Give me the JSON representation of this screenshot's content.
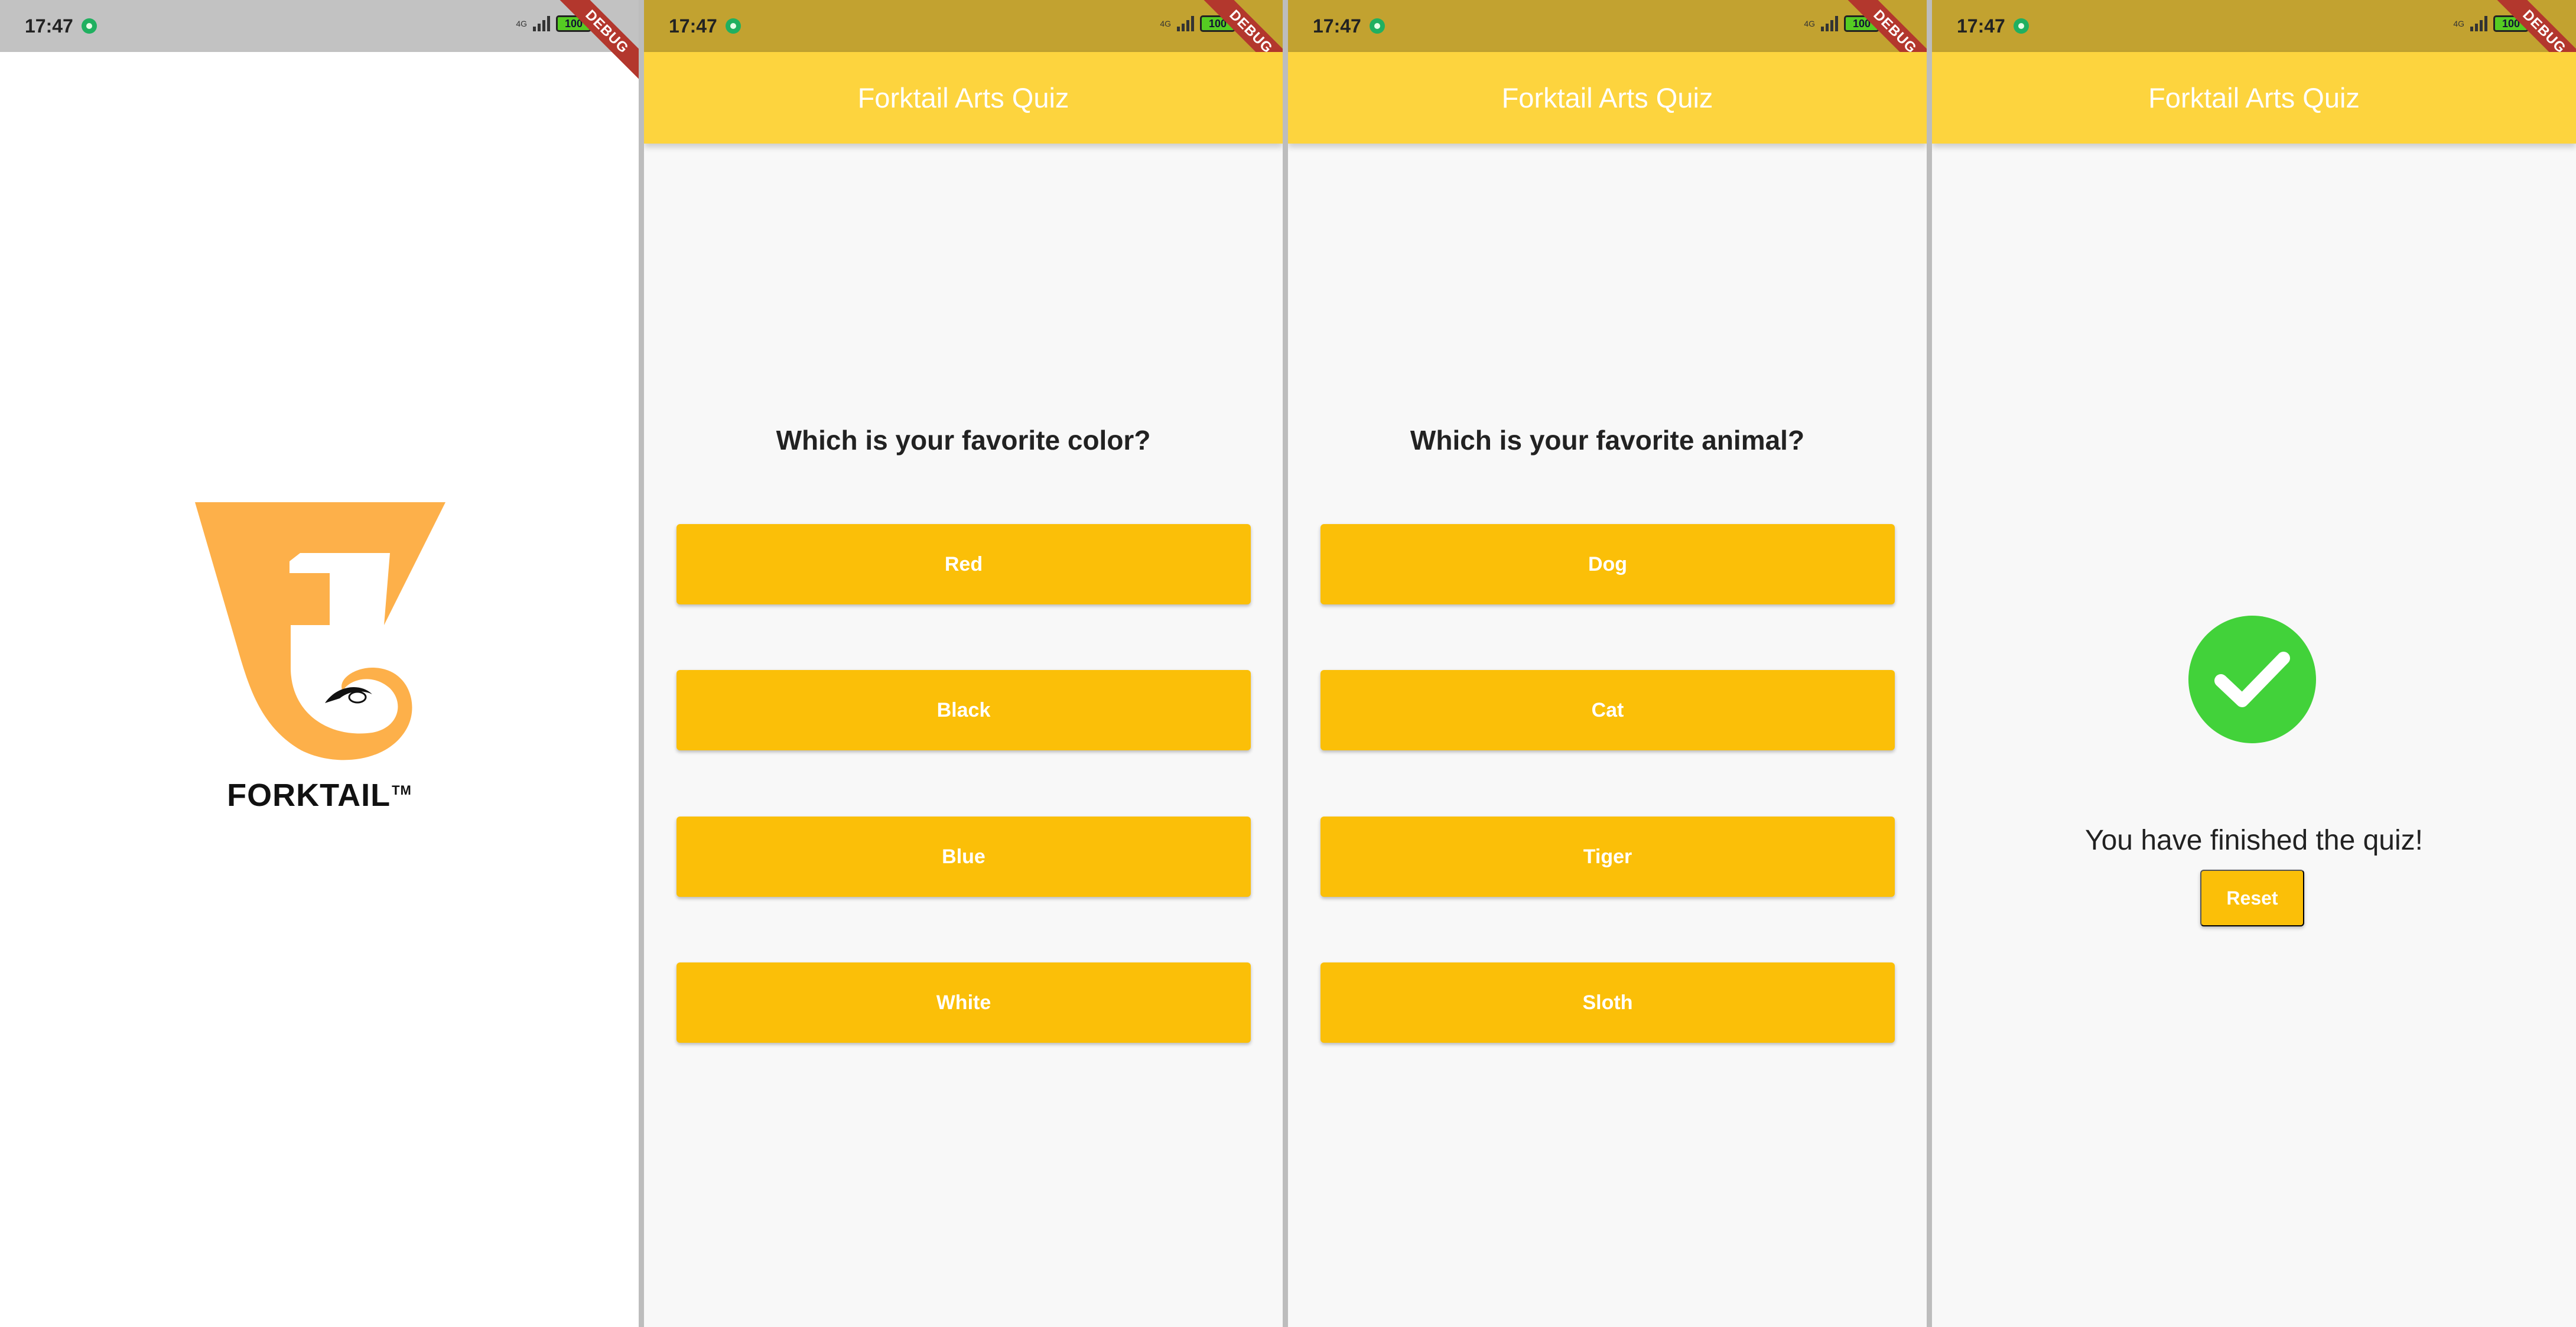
{
  "status_bar": {
    "time": "17:47",
    "network": "4G",
    "battery": "100",
    "debug_label": "DEBUG"
  },
  "splash": {
    "brand": "FORKTAIL",
    "trademark": "TM"
  },
  "app": {
    "title": "Forktail Arts Quiz",
    "accent_color": "#fdd43e",
    "button_color": "#fbbf08"
  },
  "quiz_color": {
    "question": "Which is your favorite color?",
    "answers": [
      "Red",
      "Black",
      "Blue",
      "White"
    ]
  },
  "quiz_animal": {
    "question": "Which is your favorite animal?",
    "answers": [
      "Dog",
      "Cat",
      "Tiger",
      "Sloth"
    ]
  },
  "result": {
    "message": "You have finished the quiz!",
    "reset_label": "Reset",
    "icon": "check-circle-icon"
  }
}
